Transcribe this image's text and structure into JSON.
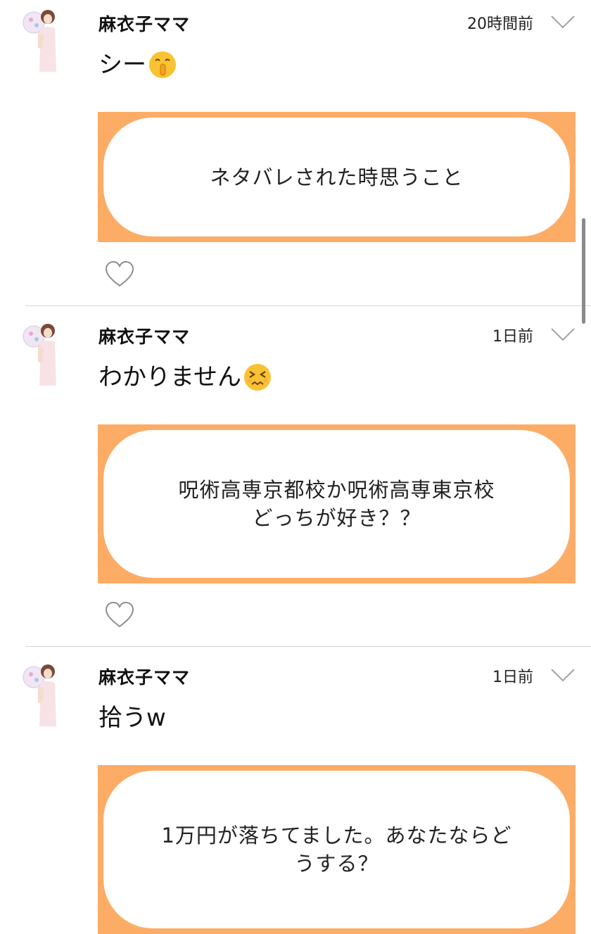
{
  "posts": [
    {
      "username": "麻衣子ママ",
      "timestamp": "20時間前",
      "reply": "シー",
      "reply_emoji": "shushing-face-emoji",
      "question": "ネタバレされた時思うこと"
    },
    {
      "username": "麻衣子ママ",
      "timestamp": "1日前",
      "reply": "わかりません",
      "reply_emoji": "persevering-face-emoji",
      "question": "呪術高専京都校か呪術高専東京校\nどっちが好き？？"
    },
    {
      "username": "麻衣子ママ",
      "timestamp": "1日前",
      "reply": "拾うw",
      "question": "1万円が落ちてました。あなたならど\nうする？"
    }
  ],
  "icons": {
    "menu": "chevron-down-icon",
    "like": "heart-outline-icon"
  },
  "colors": {
    "card_border": "#fdac66",
    "divider": "#d6d6d6",
    "icon_gray": "#a3a3a3"
  }
}
